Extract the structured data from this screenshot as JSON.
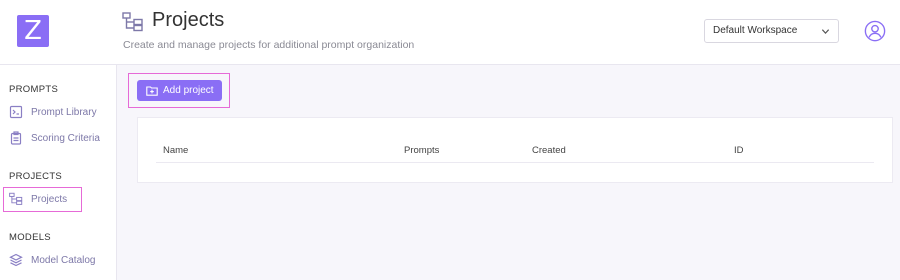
{
  "app": {
    "logo_letter": "Z"
  },
  "header": {
    "title": "Projects",
    "subtitle": "Create and manage projects for additional prompt organization",
    "workspace_select": {
      "selected": "Default Workspace"
    }
  },
  "sidebar": {
    "sections": [
      {
        "label": "PROMPTS",
        "items": [
          {
            "label": "Prompt Library"
          },
          {
            "label": "Scoring Criteria"
          }
        ]
      },
      {
        "label": "PROJECTS",
        "items": [
          {
            "label": "Projects"
          }
        ]
      },
      {
        "label": "MODELS",
        "items": [
          {
            "label": "Model Catalog"
          }
        ]
      }
    ]
  },
  "main": {
    "add_button_label": "Add project",
    "table": {
      "columns": [
        "Name",
        "Prompts",
        "Created",
        "ID"
      ],
      "rows": []
    }
  },
  "colors": {
    "accent": "#8a6ef5",
    "highlight": "#e66ad7",
    "nav_text": "#7d78a8"
  }
}
